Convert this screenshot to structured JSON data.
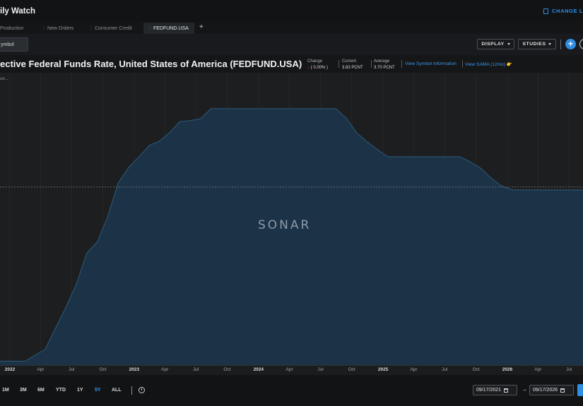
{
  "app": {
    "title": "ily Watch",
    "change_label": "CHANGE L"
  },
  "tabs": [
    {
      "label": "Production",
      "active": false
    },
    {
      "label": "New Orders",
      "active": false
    },
    {
      "label": "Consumer Credit",
      "active": false
    },
    {
      "label": "FEDFUND.USA",
      "active": true
    }
  ],
  "tab_grip": "⁞",
  "tab_add": "+",
  "toolbar": {
    "symbol_label": "ymbol",
    "display_label": "DISPLAY",
    "studies_label": "STUDIES",
    "add_label": "+"
  },
  "chart_header": {
    "title": "ective Federal Funds Rate, United States of America (FEDFUND.USA)",
    "change_label": "Change",
    "change_arrow": "↓",
    "change_value": "( 0.00% )",
    "current_label": "Current",
    "current_value": "3.83 PCNT",
    "average_label": "Average",
    "average_value": "3.70 PCNT",
    "link_symbol_info": "View Symbol Information",
    "link_sama": "View SAMA (12mo) 👉"
  },
  "chart_overlay": {
    "ellipsis": "ue...",
    "watermark": "SONAR"
  },
  "colors": {
    "accent": "#2f8de4",
    "area_fill": "#1c3246",
    "area_stroke": "#2a5470",
    "background": "#1d1e20"
  },
  "chart_data": {
    "type": "area",
    "series": [
      {
        "x": [
          "2021-09-17",
          "2021-10-15",
          "2021-11-15",
          "2021-12-15",
          "2022-01-15",
          "2022-02-15",
          "2022-03-15",
          "2022-04-15",
          "2022-05-15",
          "2022-06-15",
          "2022-07-15",
          "2022-08-15",
          "2022-09-15",
          "2022-10-15",
          "2022-11-15",
          "2022-12-15",
          "2023-01-15",
          "2023-02-15",
          "2023-03-15",
          "2023-04-15",
          "2023-05-15",
          "2023-06-15",
          "2023-07-15",
          "2023-08-15",
          "2023-09-15",
          "2023-10-15",
          "2023-11-15",
          "2023-12-15",
          "2024-01-15",
          "2024-02-15",
          "2024-03-15",
          "2024-04-15",
          "2024-05-15",
          "2024-06-15",
          "2024-07-15",
          "2024-08-15",
          "2024-09-15",
          "2024-10-15",
          "2024-11-15",
          "2024-12-15",
          "2025-01-15",
          "2025-02-15",
          "2025-03-15",
          "2025-04-15",
          "2025-05-15",
          "2025-06-15",
          "2025-07-15",
          "2025-08-15",
          "2025-09-15",
          "2025-10-15",
          "2025-11-15",
          "2025-12-15",
          "2026-01-15",
          "2026-02-15",
          "2026-03-15",
          "2026-04-15",
          "2026-05-15",
          "2026-06-15",
          "2026-07-15",
          "2026-08-15",
          "2026-09-17"
        ],
        "y": [
          0.08,
          0.08,
          0.08,
          0.08,
          0.08,
          0.08,
          0.2,
          0.33,
          0.77,
          1.21,
          1.68,
          2.33,
          2.56,
          3.08,
          3.78,
          4.1,
          4.33,
          4.57,
          4.65,
          4.83,
          5.06,
          5.08,
          5.12,
          5.33,
          5.33,
          5.33,
          5.33,
          5.33,
          5.33,
          5.33,
          5.33,
          5.33,
          5.33,
          5.33,
          5.33,
          5.33,
          5.13,
          4.83,
          4.64,
          4.48,
          4.33,
          4.33,
          4.33,
          4.33,
          4.33,
          4.33,
          4.33,
          4.33,
          4.22,
          4.09,
          3.88,
          3.72,
          3.64,
          3.64,
          3.64,
          3.64,
          3.64,
          3.64,
          3.64,
          3.64,
          3.64
        ]
      }
    ],
    "x_ticks": [
      {
        "label": "2022",
        "date": "2022-01-01",
        "year": true
      },
      {
        "label": "Apr",
        "date": "2022-04-01"
      },
      {
        "label": "Jul",
        "date": "2022-07-01"
      },
      {
        "label": "Oct",
        "date": "2022-10-01"
      },
      {
        "label": "2023",
        "date": "2023-01-01",
        "year": true
      },
      {
        "label": "Apr",
        "date": "2023-04-01"
      },
      {
        "label": "Jul",
        "date": "2023-07-01"
      },
      {
        "label": "Oct",
        "date": "2023-10-01"
      },
      {
        "label": "2024",
        "date": "2024-01-01",
        "year": true
      },
      {
        "label": "Apr",
        "date": "2024-04-01"
      },
      {
        "label": "Jul",
        "date": "2024-07-01"
      },
      {
        "label": "Oct",
        "date": "2024-10-01"
      },
      {
        "label": "2025",
        "date": "2025-01-01",
        "year": true
      },
      {
        "label": "Apr",
        "date": "2025-04-01"
      },
      {
        "label": "Jul",
        "date": "2025-07-01"
      },
      {
        "label": "Oct",
        "date": "2025-10-01"
      },
      {
        "label": "2026",
        "date": "2026-01-01",
        "year": true
      },
      {
        "label": "Apr",
        "date": "2026-04-01"
      },
      {
        "label": "Jul",
        "date": "2026-07-01"
      }
    ],
    "reference_line": 3.7,
    "ylim": [
      0,
      5.9
    ],
    "grid": true,
    "unit": "PCNT"
  },
  "range_buttons": [
    {
      "label": "1M",
      "active": false
    },
    {
      "label": "3M",
      "active": false
    },
    {
      "label": "6M",
      "active": false
    },
    {
      "label": "YTD",
      "active": false
    },
    {
      "label": "1Y",
      "active": false
    },
    {
      "label": "5Y",
      "active": true
    },
    {
      "label": "ALL",
      "active": false
    }
  ],
  "date_range": {
    "from": "09/17/2021",
    "to": "09/17/2026",
    "arrow": "→"
  }
}
